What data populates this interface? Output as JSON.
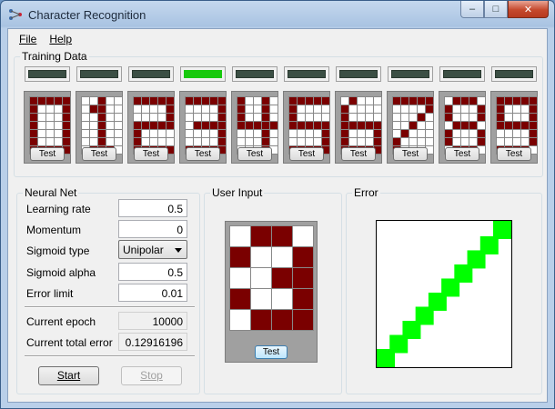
{
  "window": {
    "title": "Character Recognition",
    "icon": "neural-net-app-icon"
  },
  "caption_buttons": {
    "minimize": "–",
    "maximize": "□",
    "close": "✕"
  },
  "menu": {
    "file": "File",
    "help": "Help"
  },
  "training": {
    "title": "Training Data",
    "test_label": "Test",
    "active_index": 3,
    "led_on_color": "#17c90c",
    "led_off_color": "#3b4f44",
    "cell_on_color": "#7a0000",
    "digits": [
      [
        "11111",
        "10001",
        "10001",
        "10001",
        "10001",
        "10001",
        "11111"
      ],
      [
        "00100",
        "01100",
        "00100",
        "00100",
        "00100",
        "00100",
        "01110"
      ],
      [
        "11111",
        "00001",
        "00001",
        "11111",
        "10000",
        "10000",
        "11111"
      ],
      [
        "11111",
        "00001",
        "00001",
        "01111",
        "00001",
        "00001",
        "11111"
      ],
      [
        "10010",
        "10010",
        "10010",
        "11111",
        "00010",
        "00010",
        "00010"
      ],
      [
        "11111",
        "10000",
        "10000",
        "11111",
        "00001",
        "00001",
        "11111"
      ],
      [
        "01000",
        "10000",
        "10000",
        "11111",
        "10001",
        "10001",
        "11111"
      ],
      [
        "11111",
        "00001",
        "00010",
        "00100",
        "01000",
        "10000",
        "10000"
      ],
      [
        "01110",
        "10001",
        "10001",
        "01110",
        "10001",
        "10001",
        "01110"
      ],
      [
        "11111",
        "10001",
        "10001",
        "11111",
        "00001",
        "00001",
        "11110"
      ]
    ]
  },
  "neural_net": {
    "title": "Neural Net",
    "learning_rate_label": "Learning rate",
    "learning_rate": "0.5",
    "momentum_label": "Momentum",
    "momentum": "0",
    "sigmoid_type_label": "Sigmoid type",
    "sigmoid_type": "Unipolar",
    "sigmoid_alpha_label": "Sigmoid alpha",
    "sigmoid_alpha": "0.5",
    "error_limit_label": "Error limit",
    "error_limit": "0.01",
    "current_epoch_label": "Current epoch",
    "current_epoch": "10000",
    "current_error_label": "Current total error",
    "current_error": "0.12916196",
    "start_label": "Start",
    "stop_label": "Stop"
  },
  "user_input": {
    "title": "User Input",
    "test_label": "Test",
    "grid": [
      "0110",
      "1001",
      "0011",
      "1001",
      "0111"
    ]
  },
  "error": {
    "title": "Error",
    "line_color": "#00ff00",
    "chart_data": {
      "type": "line",
      "title": "",
      "xlabel": "",
      "ylabel": "",
      "x": [
        0,
        1,
        2,
        3,
        4,
        5,
        6,
        7,
        8,
        9
      ],
      "y": [
        0.0,
        0.11,
        0.22,
        0.33,
        0.44,
        0.55,
        0.66,
        0.77,
        0.88,
        1.0
      ]
    }
  }
}
